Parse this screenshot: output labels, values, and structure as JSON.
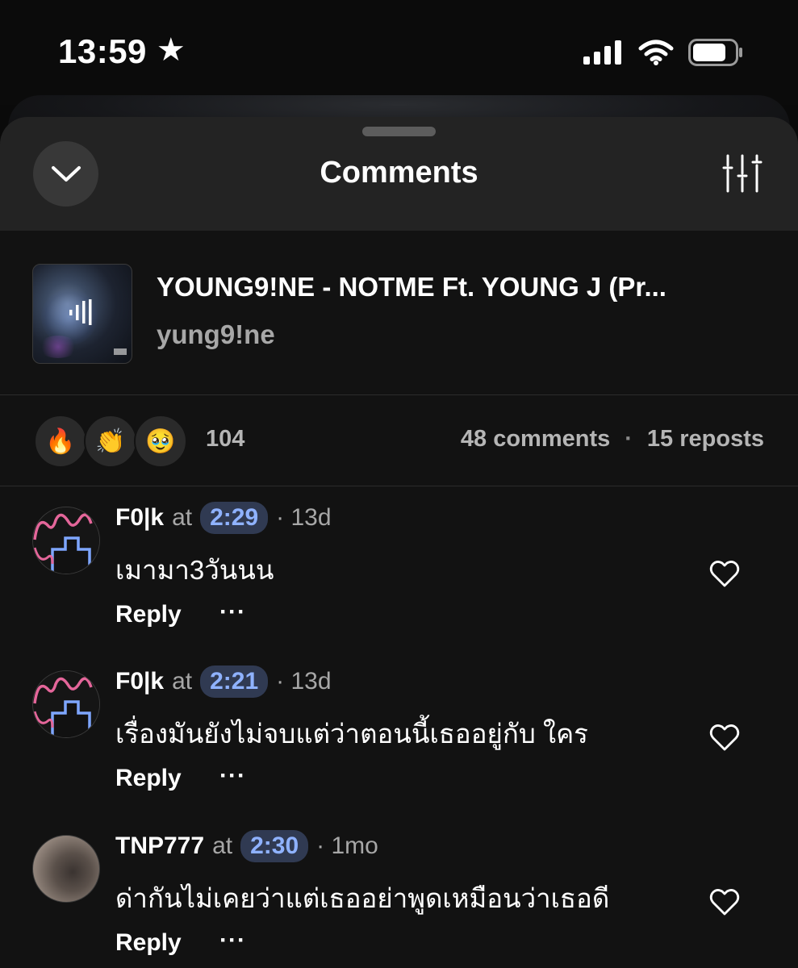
{
  "status_bar": {
    "time": "13:59",
    "icons": [
      "star-icon",
      "cellular-signal-icon",
      "wifi-icon",
      "battery-icon"
    ]
  },
  "header": {
    "title": "Comments",
    "left_icon": "chevron-down-icon",
    "right_icon": "sliders-icon"
  },
  "track": {
    "title": "YOUNG9!NE - NOTME Ft. YOUNG J (Pr...",
    "artist": "yung9!ne"
  },
  "stats": {
    "reactions": [
      "🔥",
      "👏",
      "🥹"
    ],
    "reaction_count": "104",
    "comments": "48 comments",
    "separator": "·",
    "reposts": "15 reposts"
  },
  "comments": [
    {
      "username": "F0|k",
      "at": "at",
      "timestamp": "2:29",
      "age": "· 13d",
      "text": "เมามา3วันนน",
      "reply_label": "Reply",
      "more_label": "···"
    },
    {
      "username": "F0|k",
      "at": "at",
      "timestamp": "2:21",
      "age": "· 13d",
      "text": "เรื่องมันยังไม่จบแต่ว่าตอนนี้เธออยู่กับ ใคร",
      "reply_label": "Reply",
      "more_label": "···"
    },
    {
      "username": "TNP777",
      "at": "at",
      "timestamp": "2:30",
      "age": "· 1mo",
      "text": "ด่ากันไม่เคยว่าแต่เธออย่าพูดเหมือนว่าเธอดี",
      "reply_label": "Reply",
      "more_label": "···"
    }
  ],
  "colors": {
    "background": "#121212",
    "header": "#232323",
    "timestamp_bg": "#303a52",
    "timestamp_fg": "#8fb2ff",
    "secondary_text": "#a7a7a7"
  }
}
